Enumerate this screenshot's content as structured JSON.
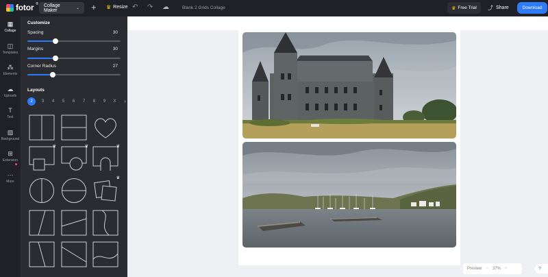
{
  "brand": {
    "name": "fotor",
    "sup": "®"
  },
  "topbar": {
    "mode": "Collage Maker",
    "resize_label": "Resize",
    "doc_title": "Blank 2 Grids Collage",
    "free_trial": "Free Trial",
    "share": "Share",
    "download": "Download"
  },
  "rail": {
    "items": [
      {
        "label": "Collage",
        "icon": "grid-icon"
      },
      {
        "label": "Templates",
        "icon": "templates-icon"
      },
      {
        "label": "Elements",
        "icon": "elements-icon"
      },
      {
        "label": "Uploads",
        "icon": "upload-icon"
      },
      {
        "label": "Text",
        "icon": "text-icon"
      },
      {
        "label": "Background",
        "icon": "background-icon"
      },
      {
        "label": "Extension",
        "icon": "extension-icon"
      },
      {
        "label": "More",
        "icon": "more-icon"
      }
    ]
  },
  "panel": {
    "heading": "Customize",
    "spacing": {
      "label": "Spacing",
      "value": "30",
      "fraction": 0.3
    },
    "margins": {
      "label": "Margins",
      "value": "30",
      "fraction": 0.3
    },
    "corner_radius": {
      "label": "Corner Radius",
      "value": "27",
      "fraction": 0.27
    },
    "layouts_heading": "Layouts",
    "pages": [
      "2",
      "3",
      "4",
      "5",
      "6",
      "7",
      "8",
      "9",
      "X"
    ],
    "active_page": "2"
  },
  "preview": {
    "label": "Preview",
    "zoom": "37%",
    "minus": "−",
    "plus": "+"
  },
  "colors": {
    "accent": "#2f7bf5",
    "dark": "#1f2126",
    "panel": "#2a2c31",
    "premium": "#f5c518"
  }
}
